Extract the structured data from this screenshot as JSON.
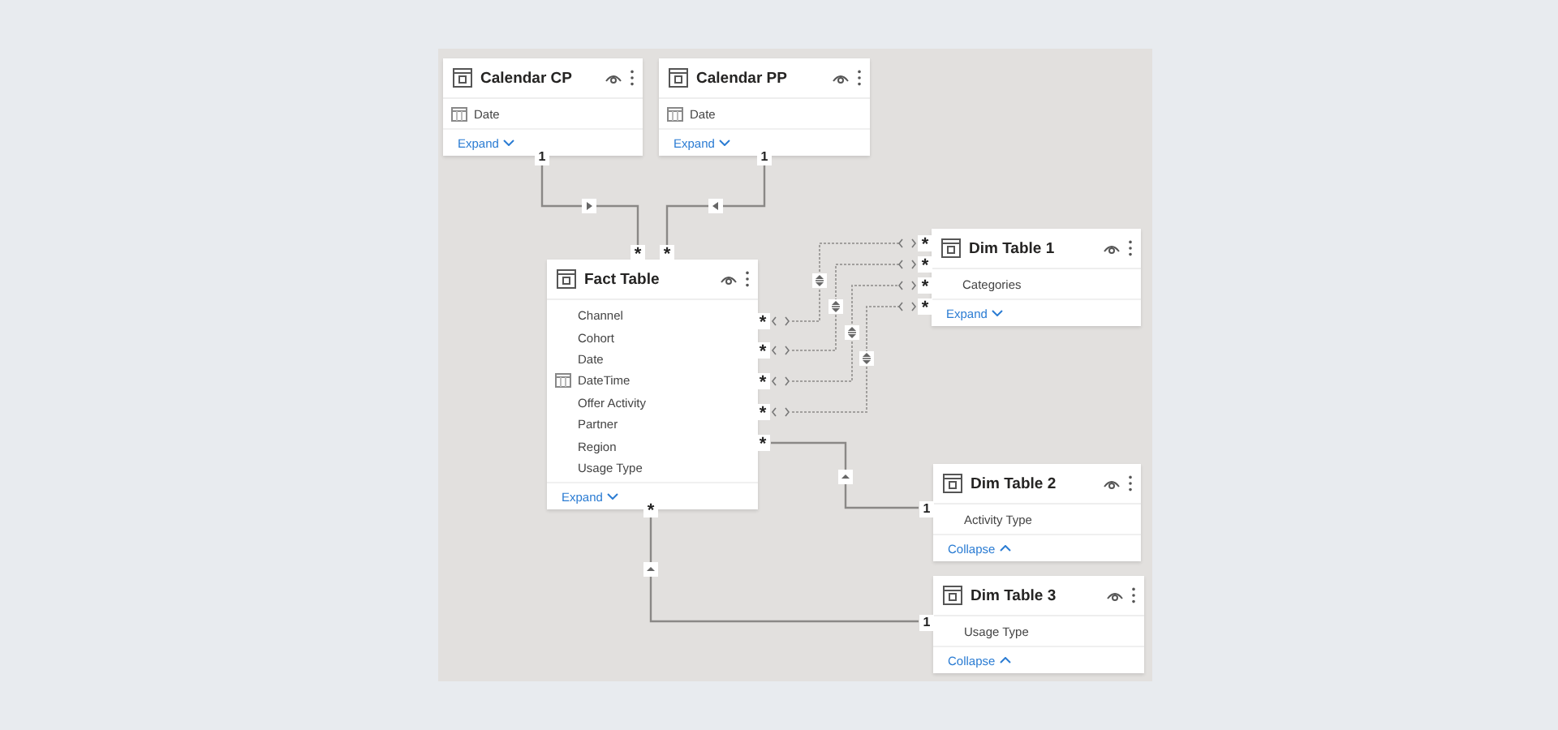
{
  "tables": [
    {
      "name": "Calendar CP",
      "fields": [
        {
          "name": "Date",
          "kind": "date"
        }
      ],
      "toggle": {
        "label": "Expand",
        "expanded": false
      }
    },
    {
      "name": "Calendar PP",
      "fields": [
        {
          "name": "Date",
          "kind": "date"
        }
      ],
      "toggle": {
        "label": "Expand",
        "expanded": false
      }
    },
    {
      "name": "Fact Table",
      "fields": [
        {
          "name": "Channel",
          "kind": "text"
        },
        {
          "name": "Cohort",
          "kind": "text"
        },
        {
          "name": "Date",
          "kind": "text"
        },
        {
          "name": "DateTime",
          "kind": "date"
        },
        {
          "name": "Offer Activity",
          "kind": "text"
        },
        {
          "name": "Partner",
          "kind": "text"
        },
        {
          "name": "Region",
          "kind": "text"
        },
        {
          "name": "Usage Type",
          "kind": "text"
        }
      ],
      "toggle": {
        "label": "Expand",
        "expanded": false
      }
    },
    {
      "name": "Dim Table 1",
      "fields": [
        {
          "name": "Categories",
          "kind": "text"
        }
      ],
      "toggle": {
        "label": "Expand",
        "expanded": false
      }
    },
    {
      "name": "Dim Table 2",
      "fields": [
        {
          "name": "Activity Type",
          "kind": "text"
        }
      ],
      "toggle": {
        "label": "Collapse",
        "expanded": true
      }
    },
    {
      "name": "Dim Table 3",
      "fields": [
        {
          "name": "Usage Type",
          "kind": "text"
        }
      ],
      "toggle": {
        "label": "Collapse",
        "expanded": true
      }
    }
  ],
  "relationships": [
    {
      "from_mark": "*",
      "to_mark": "1",
      "active": true,
      "both_directions": false
    },
    {
      "from_mark": "*",
      "to_mark": "1",
      "active": true,
      "both_directions": false
    },
    {
      "from_mark": "*",
      "to_mark": "*",
      "active": false,
      "both_directions": true
    },
    {
      "from_mark": "*",
      "to_mark": "*",
      "active": false,
      "both_directions": true
    },
    {
      "from_mark": "*",
      "to_mark": "*",
      "active": false,
      "both_directions": true
    },
    {
      "from_mark": "*",
      "to_mark": "*",
      "active": false,
      "both_directions": true
    },
    {
      "from_mark": "*",
      "to_mark": "1",
      "active": true,
      "both_directions": false
    },
    {
      "from_mark": "*",
      "to_mark": "1",
      "active": true,
      "both_directions": false
    }
  ]
}
